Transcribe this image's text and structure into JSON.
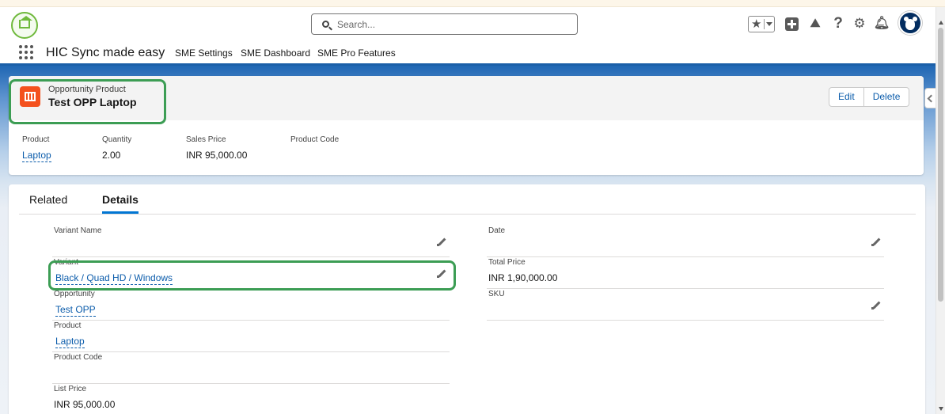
{
  "header": {
    "search_placeholder": "Search...",
    "icons": [
      "favorites-star-icon",
      "add-icon",
      "trailhead-icon",
      "help-icon",
      "setup-gear-icon",
      "notifications-bell-icon",
      "user-avatar"
    ]
  },
  "nav": {
    "app_name": "HIC Sync made easy",
    "items": [
      "SME Settings",
      "SME Dashboard",
      "SME Pro Features"
    ]
  },
  "record": {
    "object_type": "Opportunity Product",
    "name": "Test OPP Laptop",
    "actions": {
      "edit": "Edit",
      "delete": "Delete"
    },
    "highlights": [
      {
        "label": "Product",
        "value": "Laptop"
      },
      {
        "label": "Quantity",
        "value": "2.00"
      },
      {
        "label": "Sales Price",
        "value": "INR 95,000.00"
      },
      {
        "label": "Product Code",
        "value": ""
      }
    ]
  },
  "tabs": {
    "related": "Related",
    "details": "Details",
    "active": "Details"
  },
  "details": {
    "left": [
      {
        "label": "Variant Name",
        "value": ""
      },
      {
        "label": "Variant",
        "value": "Black / Quad HD / Windows"
      },
      {
        "label": "Opportunity",
        "value": "Test OPP"
      },
      {
        "label": "Product",
        "value": "Laptop"
      },
      {
        "label": "Product Code",
        "value": ""
      },
      {
        "label": "List Price",
        "value": "INR 95,000.00"
      }
    ],
    "right": [
      {
        "label": "Date",
        "value": ""
      },
      {
        "label": "Total Price",
        "value": "INR 1,90,000.00"
      },
      {
        "label": "SKU",
        "value": ""
      }
    ]
  },
  "colors": {
    "brand_blue": "#1b5fa8",
    "link": "#0b5cab",
    "object_icon": "#f4511e",
    "highlight_box": "#3c9d54"
  }
}
